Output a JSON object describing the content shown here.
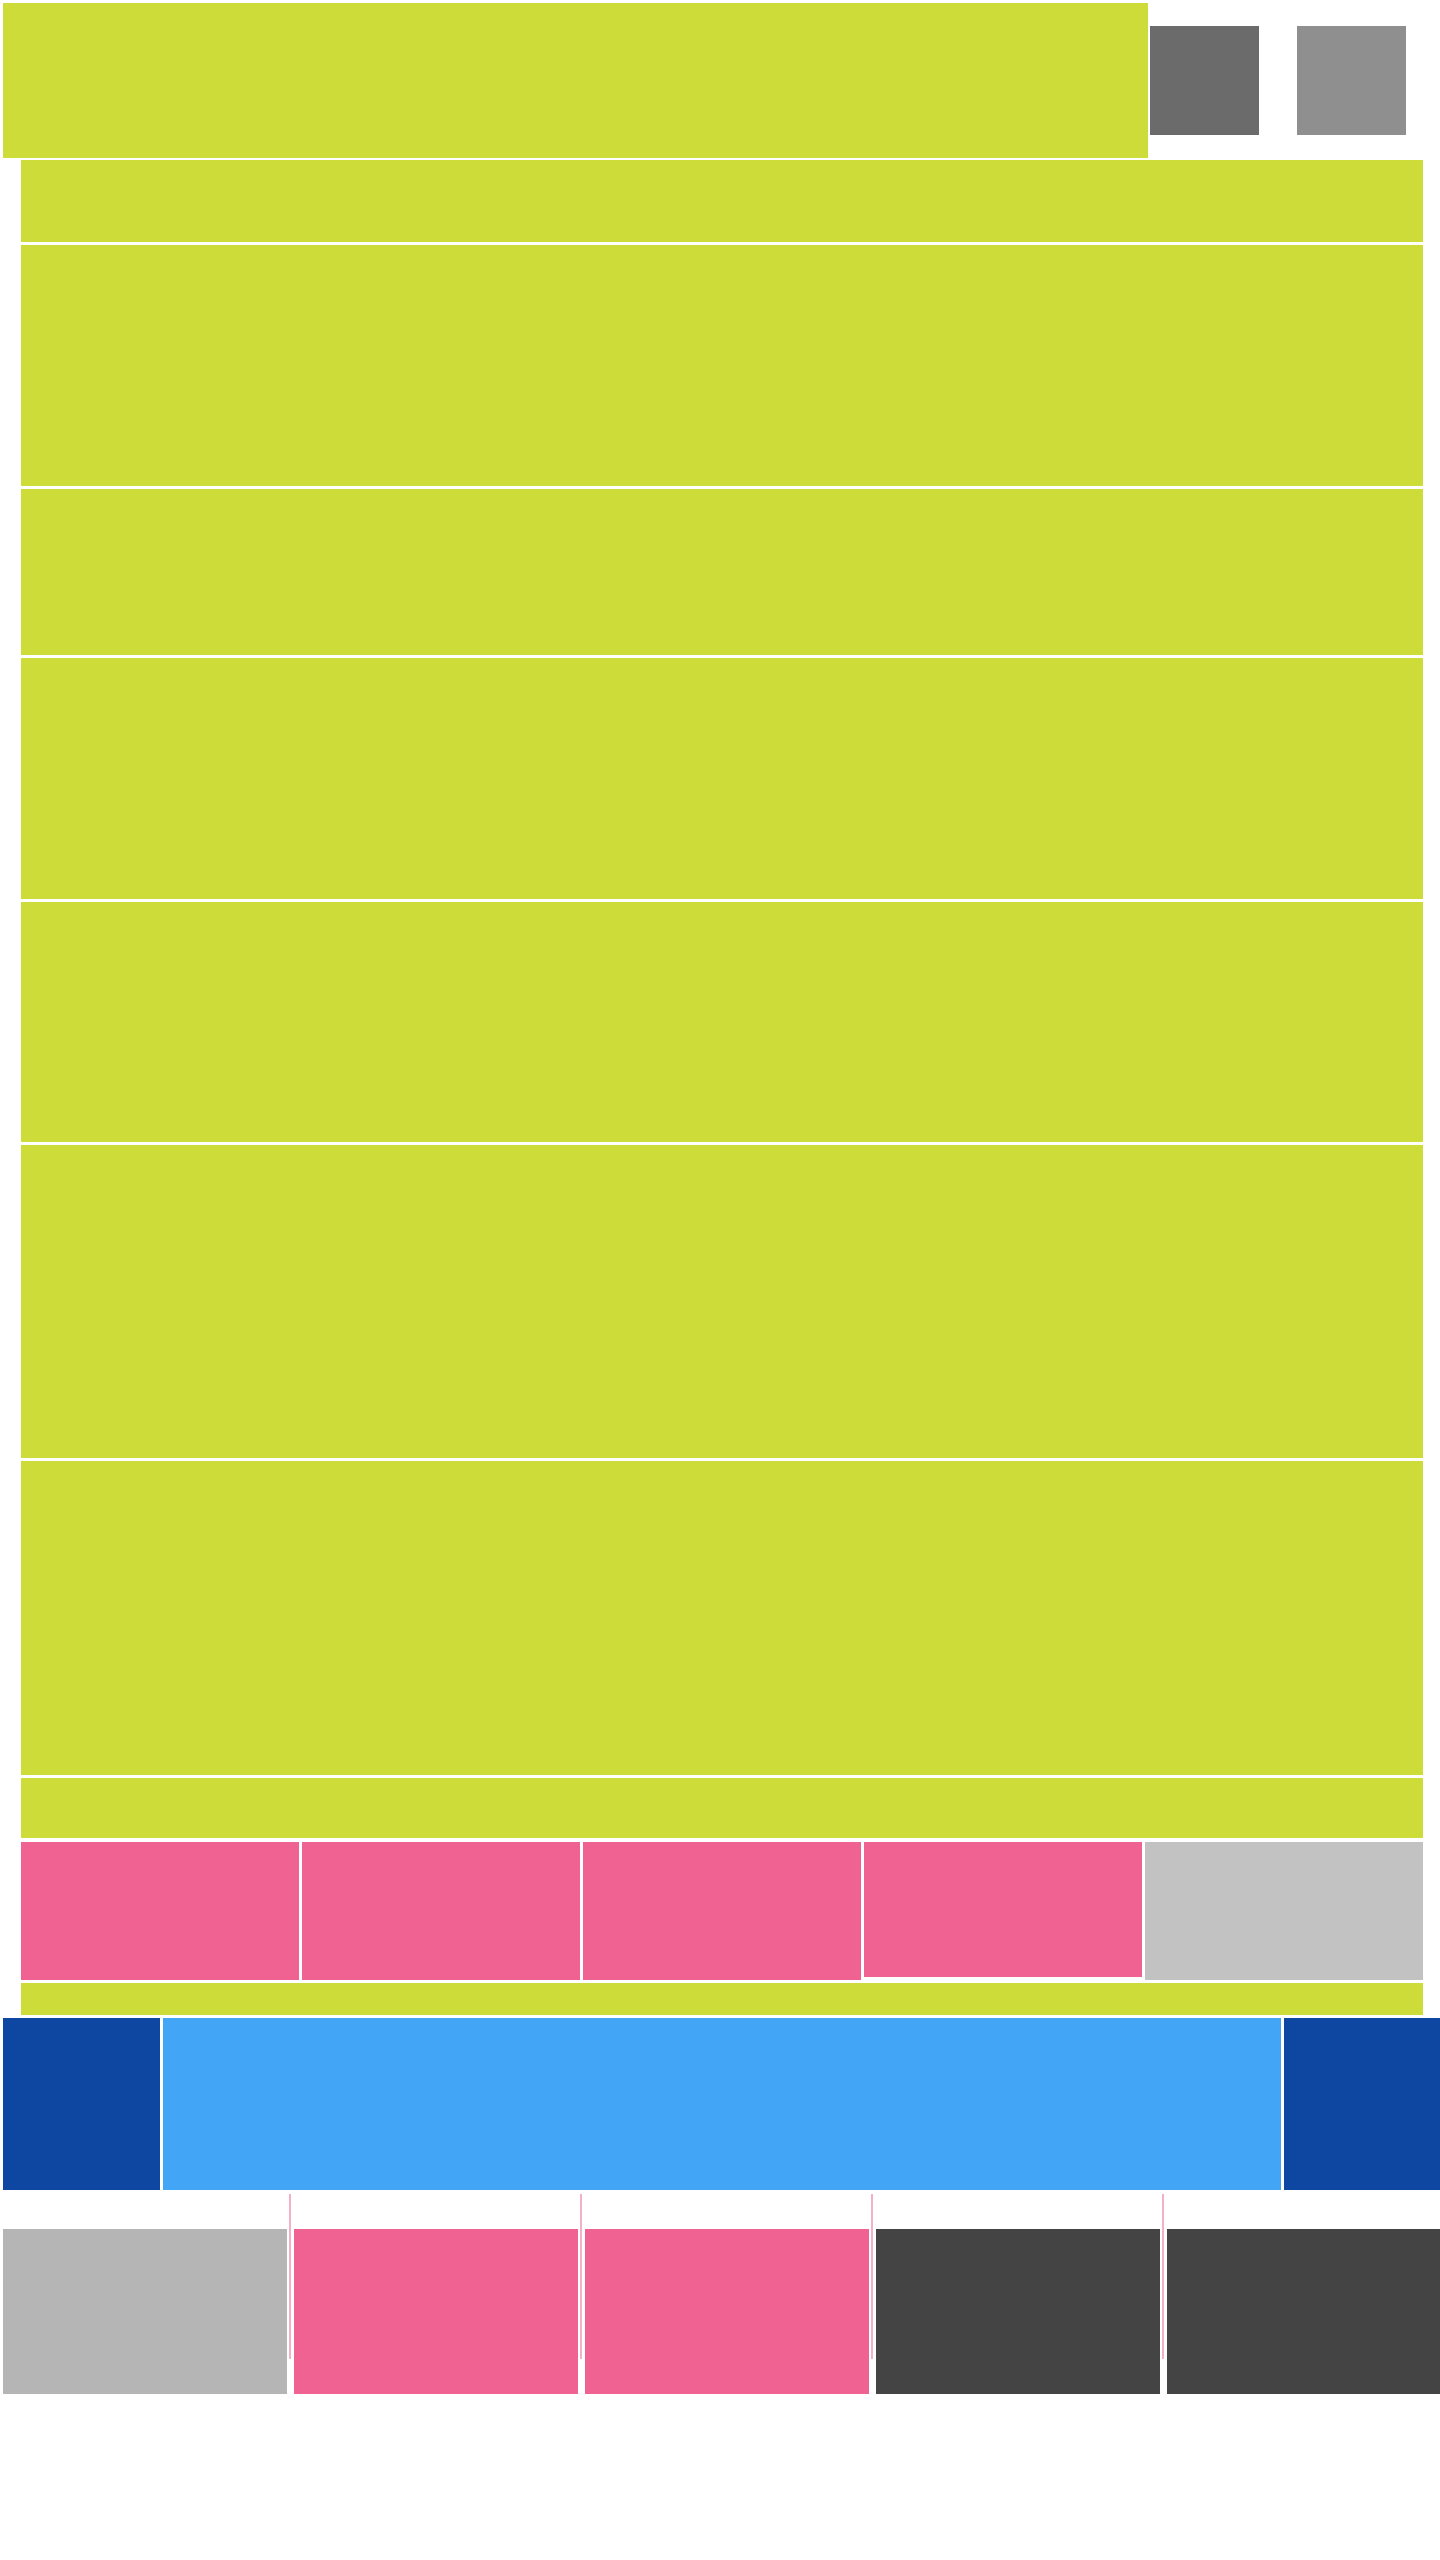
{
  "colors": {
    "content": "#cddc39",
    "accent": "#f06292",
    "primary_dark": "#0d47a1",
    "primary": "#42a5f5",
    "neutral_dark": "#444444",
    "neutral_mid": "#6b6b6b",
    "neutral_light": "#c2c2c2"
  },
  "header": {
    "title": "",
    "action_1": "",
    "action_2": ""
  },
  "list": {
    "items": [
      {
        "label": ""
      },
      {
        "label": ""
      },
      {
        "label": ""
      },
      {
        "label": ""
      },
      {
        "label": ""
      },
      {
        "label": ""
      },
      {
        "label": ""
      },
      {
        "label": ""
      }
    ]
  },
  "segments": [
    {
      "label": ""
    },
    {
      "label": ""
    },
    {
      "label": ""
    },
    {
      "label": ""
    },
    {
      "label": ""
    }
  ],
  "player": {
    "prev": "",
    "title": "",
    "next": ""
  },
  "bottom_tabs": [
    {
      "label": ""
    },
    {
      "label": ""
    },
    {
      "label": ""
    },
    {
      "label": ""
    },
    {
      "label": ""
    }
  ]
}
